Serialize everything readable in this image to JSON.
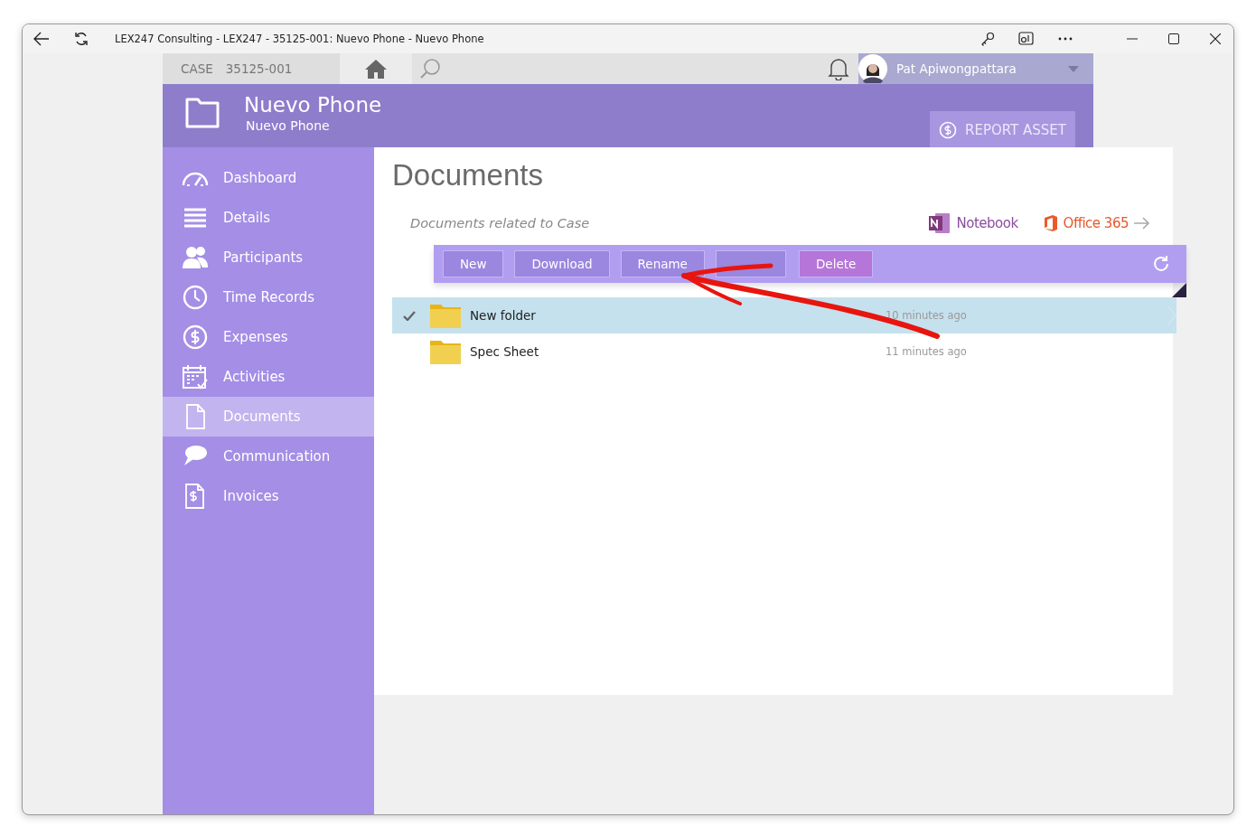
{
  "window": {
    "title": "LEX247 Consulting - LEX247 - 35125-001: Nuevo Phone - Nuevo Phone"
  },
  "topbar": {
    "case_label": "CASE",
    "case_number": "35125-001",
    "user_name": "Pat Apiwongpattara"
  },
  "header": {
    "title": "Nuevo Phone",
    "subtitle": "Nuevo Phone",
    "action": "REPORT ASSET"
  },
  "sidebar": {
    "items": [
      {
        "label": "Dashboard",
        "selected": false
      },
      {
        "label": "Details",
        "selected": false
      },
      {
        "label": "Participants",
        "selected": false
      },
      {
        "label": "Time Records",
        "selected": false
      },
      {
        "label": "Expenses",
        "selected": false
      },
      {
        "label": "Activities",
        "selected": false
      },
      {
        "label": "Documents",
        "selected": true
      },
      {
        "label": "Communication",
        "selected": false
      },
      {
        "label": "Invoices",
        "selected": false
      }
    ]
  },
  "content": {
    "title": "Documents",
    "subtitle": "Documents related to Case",
    "links": [
      {
        "label": "Notebook",
        "kind": "onenote"
      },
      {
        "label": "Office 365",
        "kind": "office"
      }
    ]
  },
  "toolbar": {
    "buttons": [
      {
        "label": "New",
        "kind": "normal"
      },
      {
        "label": "Download",
        "kind": "normal"
      },
      {
        "label": "Rename",
        "kind": "normal"
      },
      {
        "kind": "normal"
      },
      {
        "label": "Delete",
        "kind": "danger"
      }
    ]
  },
  "files": [
    {
      "name": "New folder",
      "time": "10 minutes ago",
      "selected": true
    },
    {
      "name": "Spec Sheet",
      "time": "11 minutes ago",
      "selected": false
    }
  ]
}
